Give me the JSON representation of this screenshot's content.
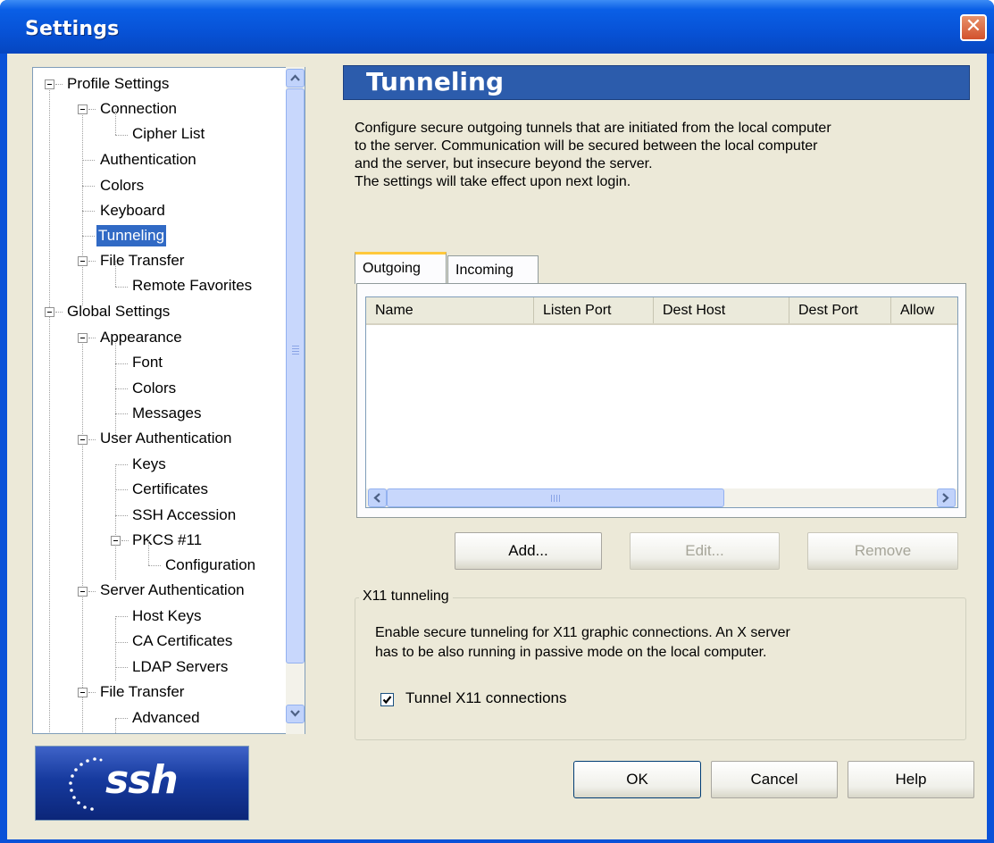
{
  "window": {
    "title": "Settings",
    "close_glyph": "✕"
  },
  "tree": {
    "items": [
      {
        "label": "Profile Settings"
      },
      {
        "label": "Connection"
      },
      {
        "label": "Cipher List"
      },
      {
        "label": "Authentication"
      },
      {
        "label": "Colors"
      },
      {
        "label": "Keyboard"
      },
      {
        "label": "Tunneling",
        "selected": true
      },
      {
        "label": "File Transfer"
      },
      {
        "label": "Remote Favorites"
      },
      {
        "label": "Global Settings"
      },
      {
        "label": "Appearance"
      },
      {
        "label": "Font"
      },
      {
        "label": "Colors"
      },
      {
        "label": "Messages"
      },
      {
        "label": "User Authentication"
      },
      {
        "label": "Keys"
      },
      {
        "label": "Certificates"
      },
      {
        "label": "SSH Accession"
      },
      {
        "label": "PKCS #11"
      },
      {
        "label": "Configuration"
      },
      {
        "label": "Server Authentication"
      },
      {
        "label": "Host Keys"
      },
      {
        "label": "CA Certificates"
      },
      {
        "label": "LDAP Servers"
      },
      {
        "label": "File Transfer"
      },
      {
        "label": "Advanced"
      }
    ]
  },
  "logo": {
    "text": "ssh"
  },
  "page": {
    "title": "Tunneling",
    "description": [
      "Configure secure outgoing tunnels that are initiated from the local computer",
      "to the server. Communication will be secured between the local computer",
      "and the server, but insecure beyond the server.",
      "The settings will take effect upon next login."
    ]
  },
  "tabs": [
    {
      "label": "Outgoing",
      "active": true
    },
    {
      "label": "Incoming",
      "active": false
    }
  ],
  "list": {
    "columns": [
      "Name",
      "Listen Port",
      "Dest Host",
      "Dest Port",
      "Allow"
    ],
    "rows": []
  },
  "actions": {
    "add": "Add...",
    "edit": "Edit...",
    "remove": "Remove"
  },
  "x11": {
    "group_label": "X11 tunneling",
    "description": [
      "Enable secure tunneling for X11 graphic connections. An X server",
      "has to be also running in passive mode on the local computer."
    ],
    "checkbox_label": "Tunnel X11 connections",
    "checked": true
  },
  "footer": {
    "ok": "OK",
    "cancel": "Cancel",
    "help": "Help"
  },
  "colors": {
    "titlebar": "#0a5fe6",
    "selection": "#316ac5",
    "header": "#2c5cac",
    "face": "#ece9d8"
  }
}
